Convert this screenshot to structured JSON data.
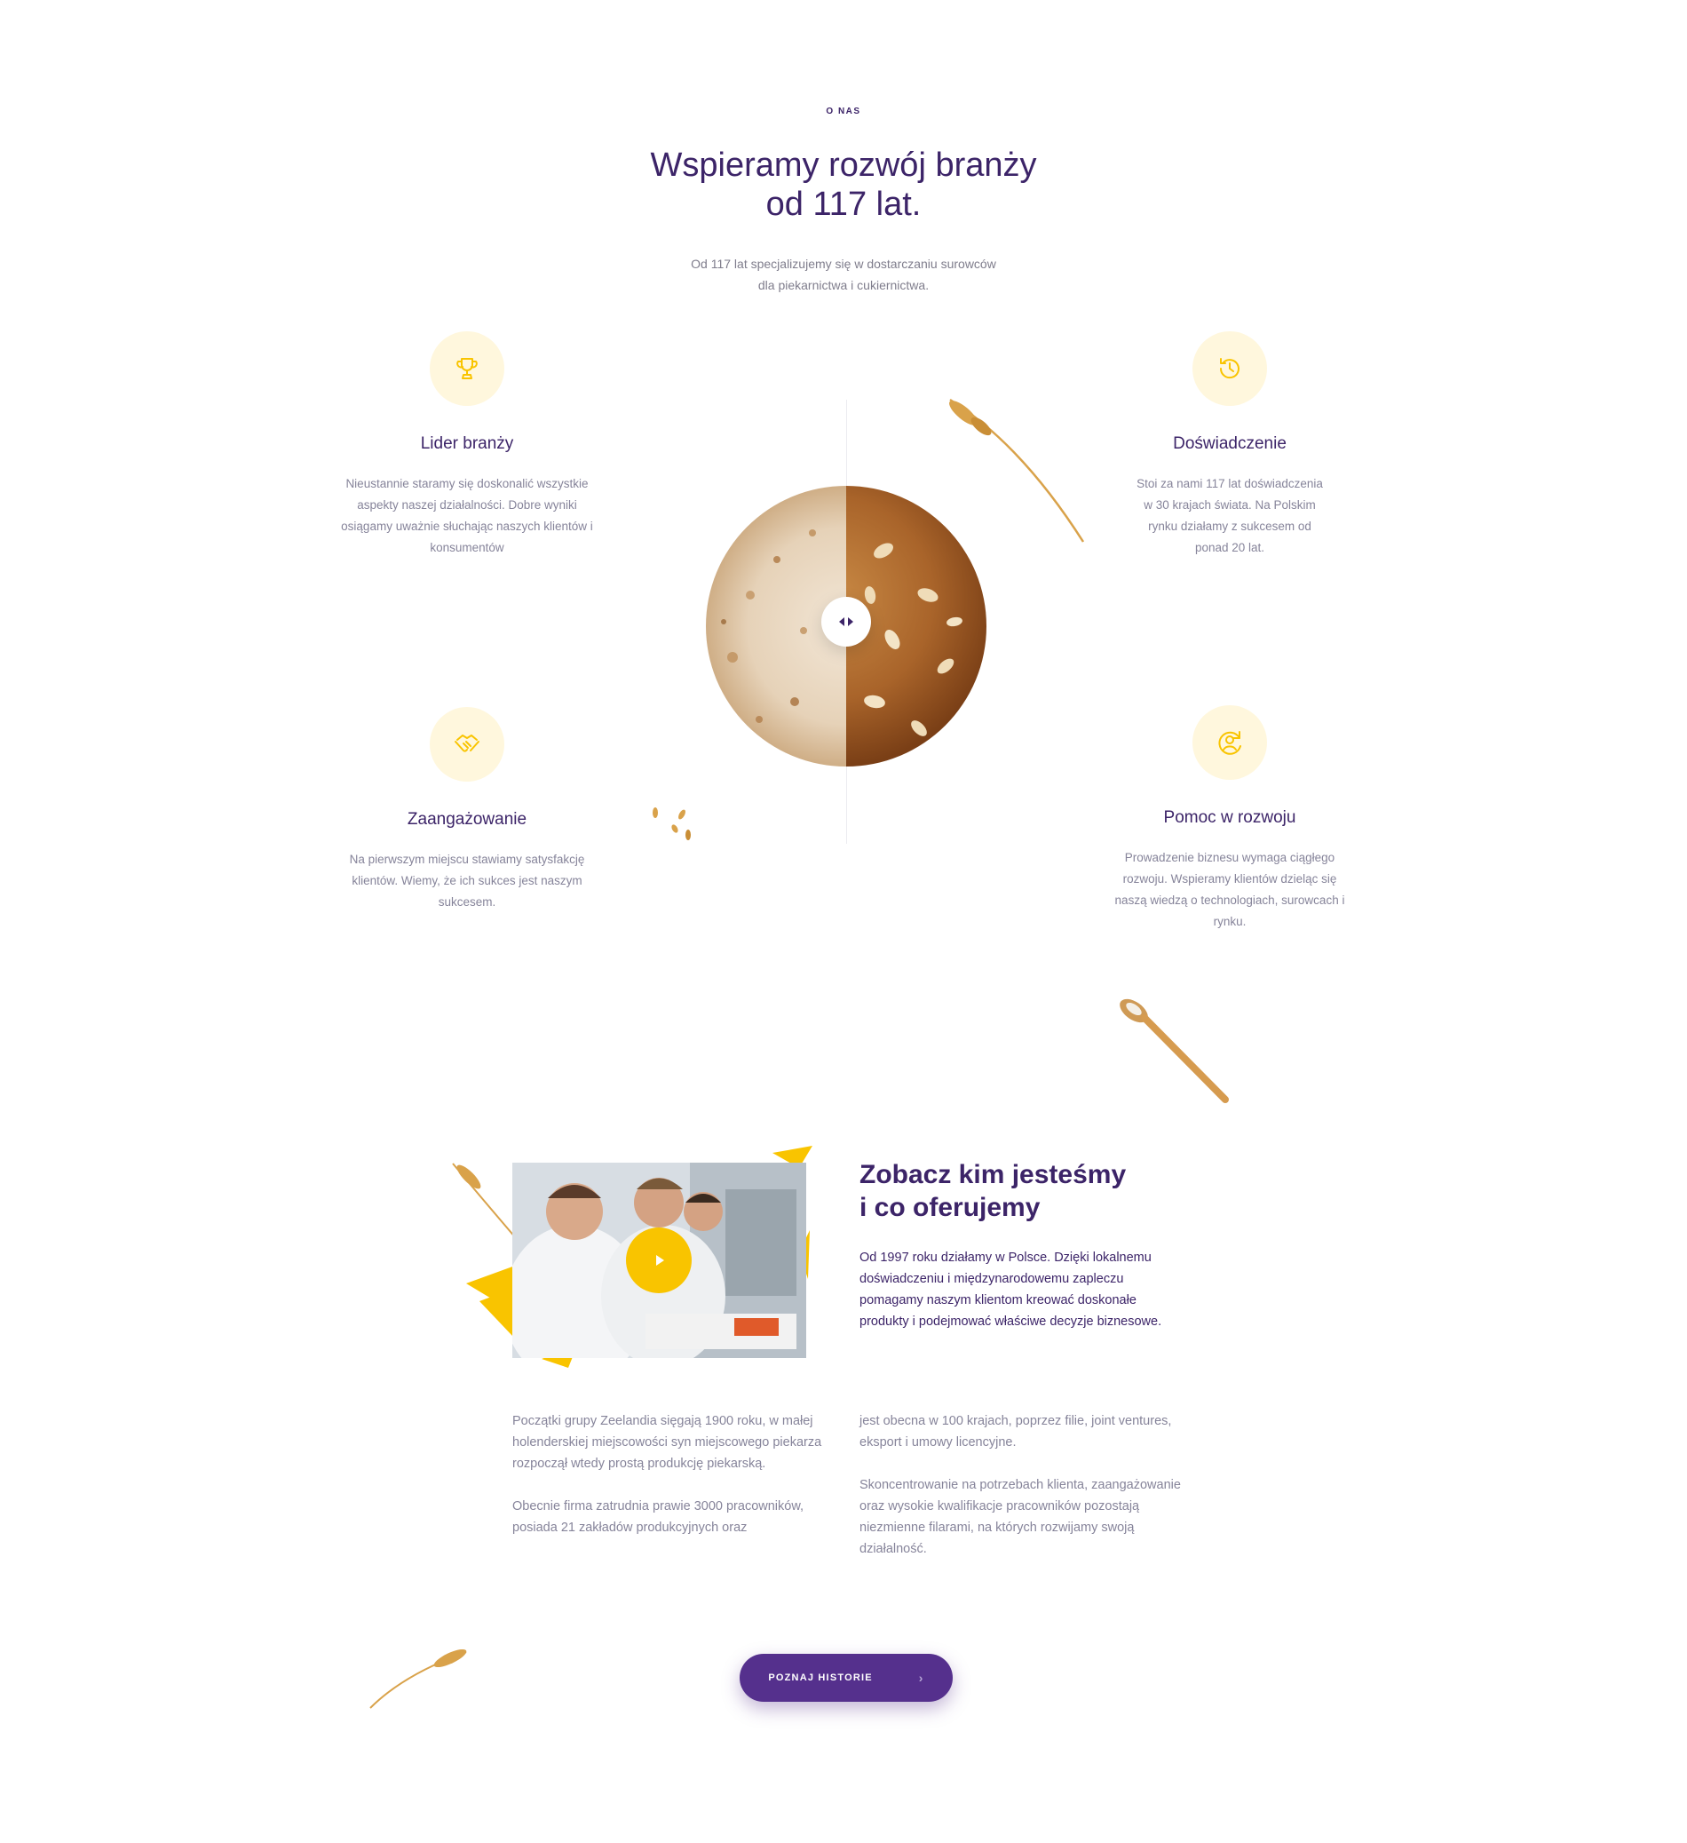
{
  "header": {
    "eyebrow": "O NAS",
    "title_line1": "Wspieramy rozwój branży",
    "title_line2": "od 117 lat.",
    "subtitle_line1": "Od 117 lat specjalizujemy się w dostarczaniu surowców",
    "subtitle_line2": "dla piekarnictwa i cukiernictwa."
  },
  "features": [
    {
      "icon": "trophy-icon",
      "title": "Lider branży",
      "text": "Nieustannie staramy się doskonalić wszystkie aspekty naszej działalności. Dobre wyniki osiągamy uważnie słuchając naszych klientów i konsumentów"
    },
    {
      "icon": "history-clock-icon",
      "title": "Doświadczenie",
      "text": "Stoi za nami 117 lat doświadczenia w 30 krajach świata. Na Polskim rynku działamy z sukcesem od ponad 20 lat."
    },
    {
      "icon": "handshake-icon",
      "title": "Zaangażowanie",
      "text": "Na pierwszym miejscu stawiamy satysfakcję klientów. Wiemy, że ich sukces jest naszym sukcesem."
    },
    {
      "icon": "user-refresh-icon",
      "title": "Pomoc w rozwoju",
      "text": "Prowadzenie biznesu wymaga ciągłego rozwoju. Wspieramy klientów dzieląc się naszą wiedzą o technologiach, surowcach i rynku."
    }
  ],
  "about": {
    "title_line1": "Zobacz kim jesteśmy",
    "title_line2": "i co oferujemy",
    "lead": "Od 1997 roku działamy w Polsce. Dzięki lokalnemu doświadczeniu i międzynarodowemu zapleczu pomagamy naszym klientom kreować doskonałe produkty i podejmować właściwe decyzje biznesowe.",
    "col1_p1": "Początki grupy Zeelandia sięgają 1900 roku, w małej holenderskiej miejscowości syn miejscowego piekarza rozpoczął wtedy prostą produkcję piekarską.",
    "col1_p2": "Obecnie firma zatrudnia prawie 3000 pracowników, posiada 21 zakładów produkcyjnych oraz",
    "col2_p1": "jest obecna w 100 krajach, poprzez filie, joint ventures, eksport i umowy licencyjne.",
    "col2_p2": "Skoncentrowanie na potrzebach klienta, zaangażowanie oraz wysokie kwalifikacje pracowników pozostają niezmienne filarami, na których rozwijamy swoją działalność."
  },
  "cta": {
    "label": "POZNAJ HISTORIE"
  },
  "colors": {
    "purple": "#3c2468",
    "button": "#55308d",
    "yellow": "#f9c400",
    "icon_bg": "#fff7dd"
  }
}
